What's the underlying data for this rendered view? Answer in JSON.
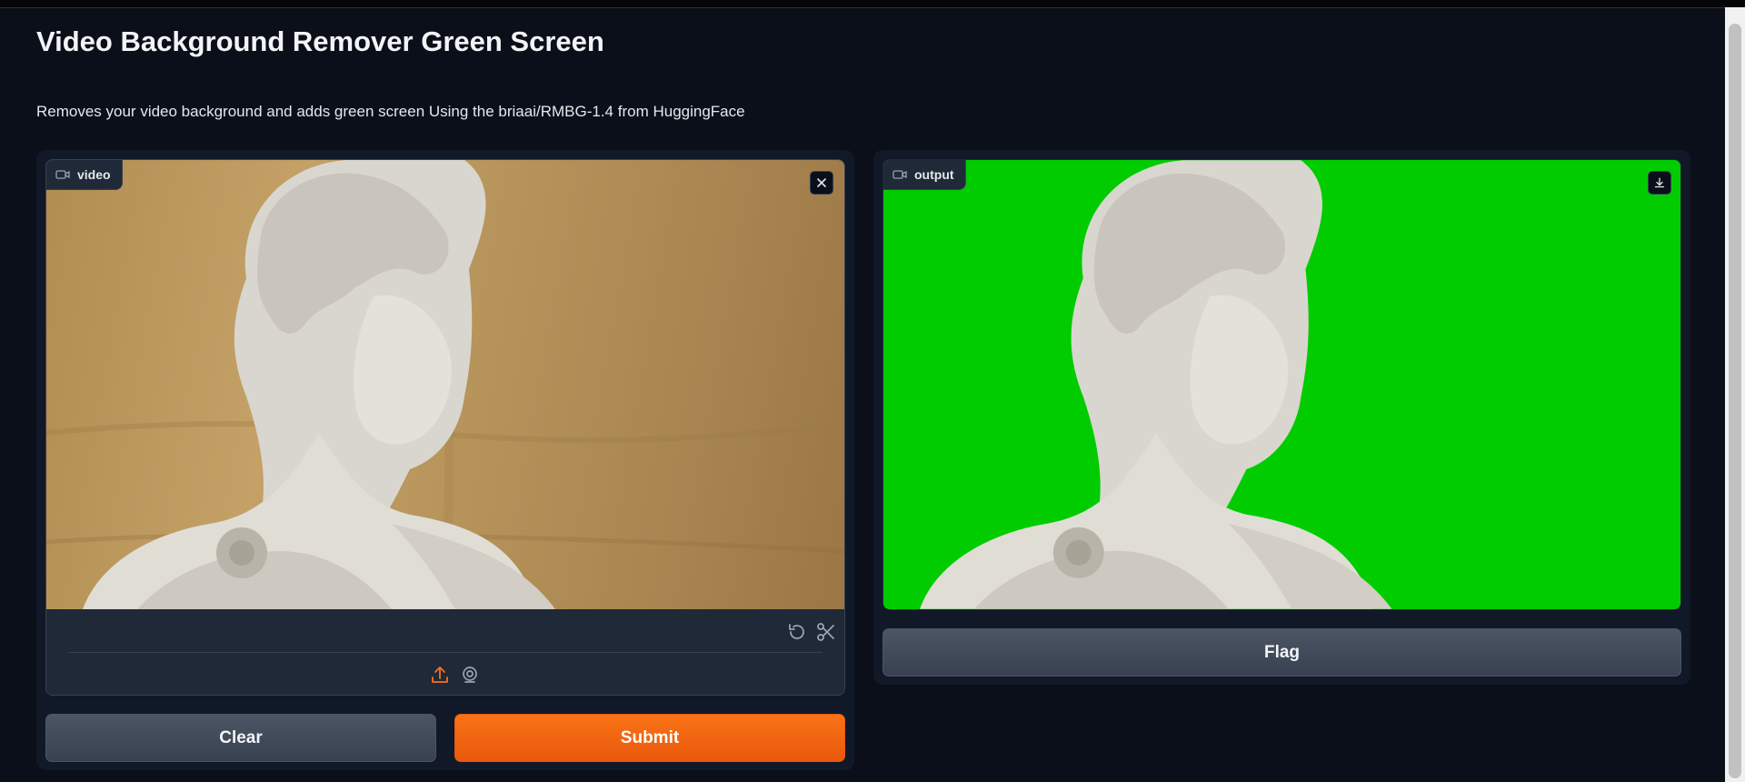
{
  "app": {
    "title": "Video Background Remover Green Screen",
    "description": "Removes your video background and adds green screen Using the briaai/RMBG-1.4 from HuggingFace"
  },
  "input_video": {
    "label": "video",
    "label_icon": "video-camera-icon",
    "clear_icon": "close-icon",
    "controls": [
      "undo-icon",
      "scissors-icon"
    ],
    "sources": [
      "upload-icon",
      "webcam-icon"
    ],
    "active_source": "upload-icon"
  },
  "output_video": {
    "label": "output",
    "label_icon": "video-camera-icon",
    "download_icon": "download-icon",
    "background_color": "#00cc00"
  },
  "buttons": {
    "clear": "Clear",
    "submit": "Submit",
    "flag": "Flag"
  },
  "colors": {
    "page_bg": "#0b0f19",
    "panel_bg": "#111827",
    "accent": "#f97316",
    "green_screen": "#00cc00"
  }
}
